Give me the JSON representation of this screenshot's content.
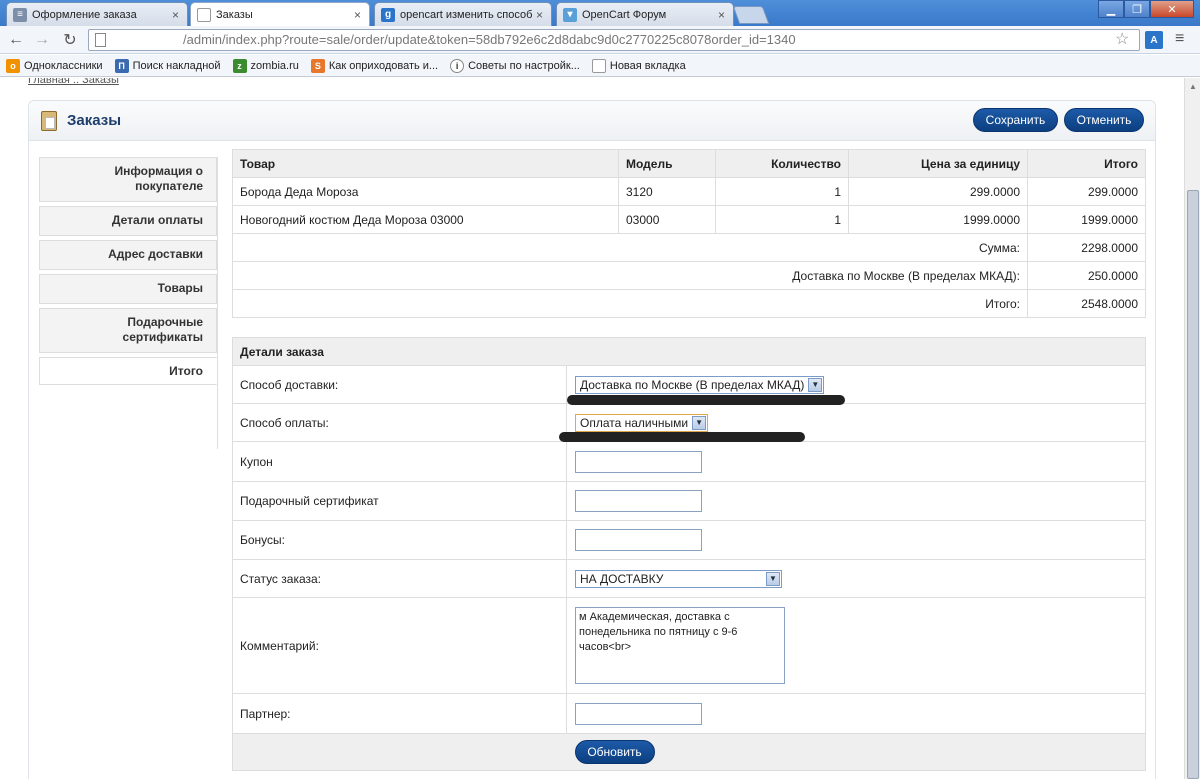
{
  "browser": {
    "tabs": [
      {
        "title": "Оформление заказа",
        "icon": "document-icon"
      },
      {
        "title": "Заказы",
        "icon": "page-icon"
      },
      {
        "title": "opencart изменить способ д",
        "icon": "google-icon"
      },
      {
        "title": "OpenCart Форум",
        "icon": "forum-icon"
      }
    ],
    "close_glyph": "×",
    "url": "/admin/index.php?route=sale/order/update&token=58db792e6c2d8dabc9d0c2770225c8078order_id=1340",
    "bookmarks": [
      {
        "label": "Одноклассники",
        "icon": "odnoklassniki-icon"
      },
      {
        "label": "Поиск накладной",
        "icon": "search-waybill-icon"
      },
      {
        "label": "zombia.ru",
        "icon": "zombia-icon"
      },
      {
        "label": "Как оприходовать и...",
        "icon": "link-icon"
      },
      {
        "label": "Советы по настройк...",
        "icon": "info-icon"
      },
      {
        "label": "Новая вкладка",
        "icon": "page-icon"
      }
    ]
  },
  "breadcrumb": "Главная :: Заказы",
  "heading": {
    "title": "Заказы",
    "save": "Сохранить",
    "cancel": "Отменить"
  },
  "sidebar": [
    {
      "label": "Информация о покупателе"
    },
    {
      "label": "Детали оплаты"
    },
    {
      "label": "Адрес доставки"
    },
    {
      "label": "Товары"
    },
    {
      "label": "Подарочные сертификаты"
    },
    {
      "label": "Итого"
    }
  ],
  "products": {
    "headers": [
      "Товар",
      "Модель",
      "Количество",
      "Цена за единицу",
      "Итого"
    ],
    "rows": [
      [
        "Борода Деда Мороза",
        "3120",
        "1",
        "299.0000",
        "299.0000"
      ],
      [
        "Новогодний костюм Деда Мороза 03000",
        "03000",
        "1",
        "1999.0000",
        "1999.0000"
      ]
    ],
    "totals": [
      {
        "label": "Сумма:",
        "value": "2298.0000"
      },
      {
        "label": "Доставка по Москве (В пределах МКАД):",
        "value": "250.0000"
      },
      {
        "label": "Итого:",
        "value": "2548.0000"
      }
    ]
  },
  "details": {
    "header": "Детали заказа",
    "shipping_label": "Способ доставки:",
    "shipping_value": "Доставка по Москве (В пределах МКАД)",
    "payment_label": "Способ оплаты:",
    "payment_value": "Оплата наличными",
    "coupon_label": "Купон",
    "coupon_value": "",
    "voucher_label": "Подарочный сертификат",
    "voucher_value": "",
    "reward_label": "Бонусы:",
    "reward_value": "",
    "status_label": "Статус заказа:",
    "status_value": "НА ДОСТАВКУ",
    "comment_label": "Комментарий:",
    "comment_value": "м Академическая, доставка с понедельника по пятницу с 9-6 часов<br>",
    "affiliate_label": "Партнер:",
    "affiliate_value": "",
    "update_button": "Обновить"
  }
}
